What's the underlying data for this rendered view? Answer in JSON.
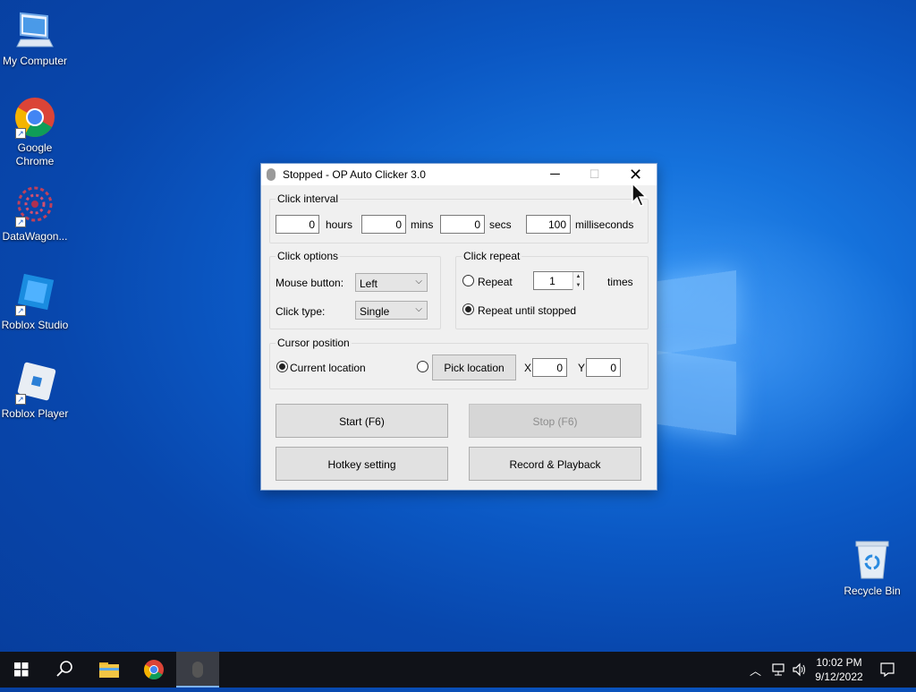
{
  "desktop": {
    "icons": [
      {
        "label": "My Computer",
        "icon": "computer-icon"
      },
      {
        "label": "Google Chrome",
        "icon": "chrome-icon"
      },
      {
        "label": "DataWagon...",
        "icon": "datawagon-icon"
      },
      {
        "label": "Roblox Studio",
        "icon": "roblox-studio-icon"
      },
      {
        "label": "Roblox Player",
        "icon": "roblox-player-icon"
      },
      {
        "label": "Recycle Bin",
        "icon": "recycle-bin-icon"
      }
    ]
  },
  "window": {
    "title": "Stopped - OP Auto Clicker 3.0",
    "click_interval": {
      "label": "Click interval",
      "hours": "0",
      "hours_label": "hours",
      "mins": "0",
      "mins_label": "mins",
      "secs": "0",
      "secs_label": "secs",
      "milliseconds": "100",
      "milliseconds_label": "milliseconds"
    },
    "click_options": {
      "label": "Click options",
      "mouse_button_label": "Mouse button:",
      "mouse_button_value": "Left",
      "click_type_label": "Click type:",
      "click_type_value": "Single"
    },
    "click_repeat": {
      "label": "Click repeat",
      "repeat_label": "Repeat",
      "repeat_count": "1",
      "times_label": "times",
      "until_stopped_label": "Repeat until stopped",
      "selected": "until_stopped"
    },
    "cursor_position": {
      "label": "Cursor position",
      "current_label": "Current location",
      "pick_label": "Pick location",
      "x_label": "X",
      "x_value": "0",
      "y_label": "Y",
      "y_value": "0",
      "selected": "current"
    },
    "buttons": {
      "start": "Start (F6)",
      "stop": "Stop (F6)",
      "hotkey": "Hotkey setting",
      "record": "Record & Playback"
    }
  },
  "taskbar": {
    "time": "10:02 PM",
    "date": "9/12/2022"
  },
  "colors": {
    "desktop_bg": "#0b58c4",
    "taskbar_bg": "#101218",
    "window_bg": "#f0f0f0"
  }
}
